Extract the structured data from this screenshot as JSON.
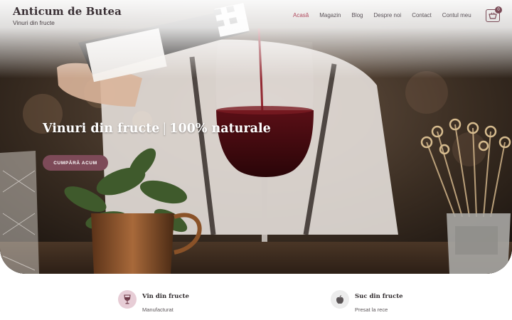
{
  "brand": {
    "title": "Anticum de Butea",
    "tagline": "Vinuri din fructe"
  },
  "nav": {
    "items": [
      {
        "label": "Acasă",
        "active": true
      },
      {
        "label": "Magazin",
        "active": false
      },
      {
        "label": "Blog",
        "active": false
      },
      {
        "label": "Despre noi",
        "active": false
      },
      {
        "label": "Contact",
        "active": false
      },
      {
        "label": "Contul meu",
        "active": false
      }
    ]
  },
  "cart": {
    "count": "0",
    "icon": "basket-icon"
  },
  "hero": {
    "headline_left": "Vinuri din fructe",
    "headline_separator": "|",
    "headline_right": "100% naturale",
    "cta_label": "CUMPĂRĂ ACUM"
  },
  "features": [
    {
      "title": "Vin din fructe",
      "subtitle": "Manufacturat",
      "icon": "wine-glass-icon"
    },
    {
      "title": "Suc din fructe",
      "subtitle": "Presat la rece",
      "icon": "apple-icon"
    }
  ],
  "colors": {
    "accent": "#7d4a58",
    "nav_active": "#b04a5e",
    "feature_icon_1_bg": "#e7cdd6",
    "feature_icon_2_bg": "#ececec"
  }
}
